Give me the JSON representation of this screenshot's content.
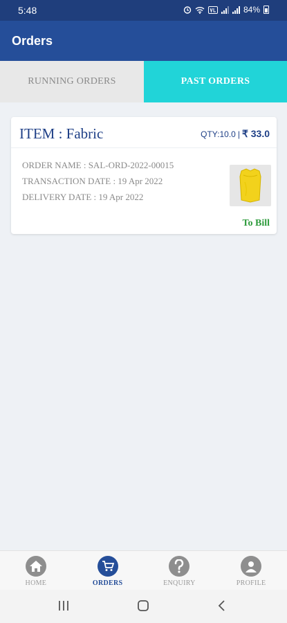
{
  "status_bar": {
    "time": "5:48",
    "battery": "84%",
    "icons": [
      "alarm-icon",
      "wifi-icon",
      "volte-icon",
      "signal-icon",
      "signal-icon",
      "battery-icon"
    ]
  },
  "app_bar": {
    "title": "Orders"
  },
  "tabs": [
    {
      "label": "RUNNING ORDERS",
      "active": false
    },
    {
      "label": "PAST ORDERS",
      "active": true
    }
  ],
  "orders": [
    {
      "item": "ITEM : Fabric",
      "qty": "QTY:10.0",
      "separator": "|",
      "price": "₹ 33.0",
      "order_name": "ORDER NAME : SAL-ORD-2022-00015",
      "transaction_date": "TRANSACTION DATE : 19 Apr 2022",
      "delivery_date": "DELIVERY DATE : 19 Apr 2022",
      "status": "To Bill",
      "thumbnail": "yellow-bag-image"
    }
  ],
  "bottom_nav": [
    {
      "label": "HOME",
      "icon": "home-icon",
      "active": false
    },
    {
      "label": "ORDERS",
      "icon": "cart-icon",
      "active": true
    },
    {
      "label": "ENQUIRY",
      "icon": "question-icon",
      "active": false
    },
    {
      "label": "PROFILE",
      "icon": "person-icon",
      "active": false
    }
  ],
  "colors": {
    "status_bar": "#1f3e7c",
    "app_bar": "#254e99",
    "active_tab": "#21d4d8",
    "inactive_tab": "#e8e8e8",
    "item_title": "#1e3f86",
    "status_text": "#2e9b3c",
    "background": "#eef1f5"
  }
}
